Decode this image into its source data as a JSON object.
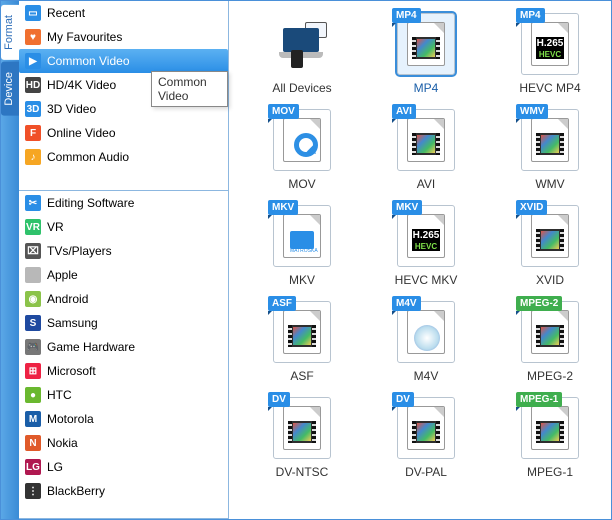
{
  "tabs": {
    "format": "Format",
    "device": "Device"
  },
  "format_items": [
    {
      "label": "Recent",
      "icon": "recent-icon",
      "bg": "#2a8ee6"
    },
    {
      "label": "My Favourites",
      "icon": "heart-icon",
      "bg": "#f07030"
    },
    {
      "label": "Common Video",
      "icon": "video-icon",
      "bg": "#2a8ee6",
      "selected": true
    },
    {
      "label": "HD/4K Video",
      "icon": "hd-icon",
      "bg": "#444"
    },
    {
      "label": "3D Video",
      "icon": "3d-icon",
      "bg": "#2a8ee6"
    },
    {
      "label": "Online Video",
      "icon": "online-icon",
      "bg": "#f05028"
    },
    {
      "label": "Common Audio",
      "icon": "audio-icon",
      "bg": "#f6a623"
    }
  ],
  "device_items": [
    {
      "label": "Editing Software",
      "icon": "editing-icon",
      "bg": "#2a8ee6"
    },
    {
      "label": "VR",
      "icon": "vr-icon",
      "bg": "#2fc26b"
    },
    {
      "label": "TVs/Players",
      "icon": "tv-icon",
      "bg": "#555"
    },
    {
      "label": "Apple",
      "icon": "apple-icon",
      "bg": "#b8b8b8"
    },
    {
      "label": "Android",
      "icon": "android-icon",
      "bg": "#8bc34a"
    },
    {
      "label": "Samsung",
      "icon": "samsung-icon",
      "bg": "#1f4aa0"
    },
    {
      "label": "Game Hardware",
      "icon": "game-icon",
      "bg": "#777"
    },
    {
      "label": "Microsoft",
      "icon": "microsoft-icon",
      "bg": "#e24"
    },
    {
      "label": "HTC",
      "icon": "htc-icon",
      "bg": "#6ab82f"
    },
    {
      "label": "Motorola",
      "icon": "motorola-icon",
      "bg": "#1a5ea8"
    },
    {
      "label": "Nokia",
      "icon": "nokia-icon",
      "bg": "#e05a2a"
    },
    {
      "label": "LG",
      "icon": "lg-icon",
      "bg": "#b01850"
    },
    {
      "label": "BlackBerry",
      "icon": "blackberry-icon",
      "bg": "#333"
    }
  ],
  "tooltip": "Common Video",
  "grid": [
    {
      "label": "All Devices",
      "type": "devices"
    },
    {
      "label": "MP4",
      "badge": "MP4",
      "type": "film",
      "selected": true
    },
    {
      "label": "HEVC MP4",
      "badge": "MP4",
      "type": "hevc"
    },
    {
      "label": "MOV",
      "badge": "MOV",
      "type": "qt"
    },
    {
      "label": "AVI",
      "badge": "AVI",
      "type": "film"
    },
    {
      "label": "WMV",
      "badge": "WMV",
      "type": "film"
    },
    {
      "label": "MKV",
      "badge": "MKV",
      "type": "mkv"
    },
    {
      "label": "HEVC MKV",
      "badge": "MKV",
      "type": "hevc"
    },
    {
      "label": "XVID",
      "badge": "XVID",
      "type": "film"
    },
    {
      "label": "ASF",
      "badge": "ASF",
      "type": "film"
    },
    {
      "label": "M4V",
      "badge": "M4V",
      "type": "m4v"
    },
    {
      "label": "MPEG-2",
      "badge": "MPEG-2",
      "type": "film",
      "badgeColor": "#3fae4e"
    },
    {
      "label": "DV-NTSC",
      "badge": "DV",
      "type": "film"
    },
    {
      "label": "DV-PAL",
      "badge": "DV",
      "type": "film"
    },
    {
      "label": "MPEG-1",
      "badge": "MPEG-1",
      "type": "film",
      "badgeColor": "#3fae4e"
    }
  ]
}
